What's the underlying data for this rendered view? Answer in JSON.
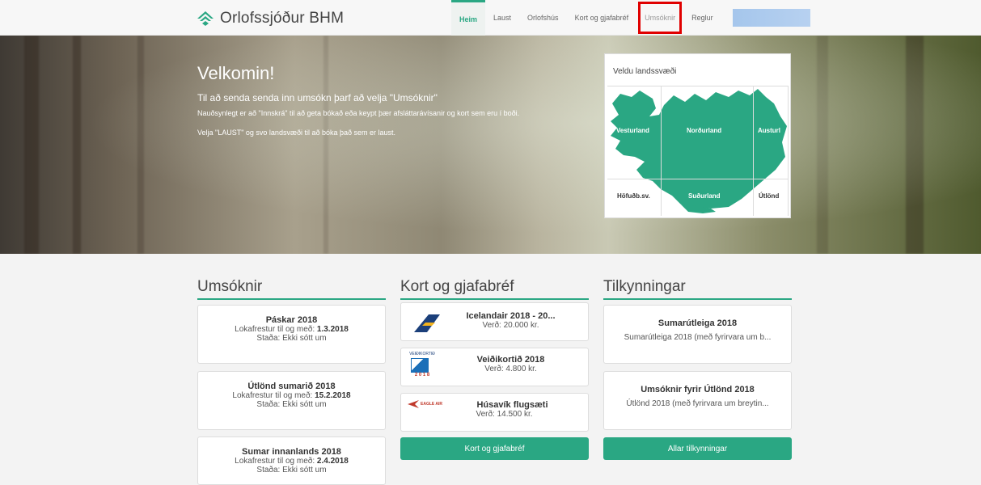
{
  "header": {
    "logo_text": "Orlofssjóður BHM",
    "nav": [
      {
        "label": "Heim"
      },
      {
        "label": "Laust"
      },
      {
        "label": "Orlofshús"
      },
      {
        "label": "Kort og gjafabréf"
      },
      {
        "label": "Umsóknir"
      },
      {
        "label": "Reglur"
      }
    ]
  },
  "hero": {
    "title": "Velkomin!",
    "subtitle": "Til að senda senda inn umsókn þarf að velja \"Umsóknir\"",
    "note1": "Nauðsynlegt er að \"Innskrá\" til að geta bókað eða keypt þær afsláttarávísanir  og kort sem eru í boði.",
    "note2": "Velja \"LAUST\" og svo landsvæði til að bóka það sem er laust."
  },
  "map": {
    "title": "Veldu landssvæði",
    "regions": [
      "Vesturland",
      "Norðurland",
      "Austurl",
      "Höfuðb.sv.",
      "Suðurland",
      "Útlönd"
    ],
    "color": "#2aa783"
  },
  "umsoknir": {
    "heading": "Umsóknir",
    "items": [
      {
        "title": "Páskar 2018",
        "deadline_label": "Lokafrestur til og með:",
        "deadline": "1.3.2018",
        "status": "Staða: Ekki sótt um"
      },
      {
        "title": "Útlönd sumarið 2018",
        "deadline_label": "Lokafrestur til og með:",
        "deadline": "15.2.2018",
        "status": "Staða: Ekki sótt um"
      },
      {
        "title": "Sumar innanlands 2018",
        "deadline_label": "Lokafrestur til og með:",
        "deadline": "2.4.2018",
        "status": "Staða: Ekki sótt um"
      }
    ]
  },
  "kort": {
    "heading": "Kort og gjafabréf",
    "items": [
      {
        "title": "Icelandair 2018 - 20...",
        "price": "Verð: 20.000 kr."
      },
      {
        "title": "Veiðikortið 2018",
        "price": "Verð: 4.800 kr.",
        "thumb_text": "VEIÐIKORTIÐ",
        "thumb_year": "2 0 1 8"
      },
      {
        "title": "Húsavík flugsæti",
        "price": "Verð: 14.500 kr.",
        "thumb_text": "EAGLE AIR"
      }
    ],
    "button": "Kort og gjafabréf"
  },
  "tilkynningar": {
    "heading": "Tilkynningar",
    "items": [
      {
        "title": "Sumarútleiga 2018",
        "text": "Sumarútleiga 2018 (með fyrirvara um b..."
      },
      {
        "title": "Umsóknir fyrir Útlönd 2018",
        "text": "Útlönd 2018 (með fyrirvara um breytin..."
      }
    ],
    "button": "Allar tilkynningar"
  },
  "colors": {
    "accent": "#2aa783",
    "highlight": "#e00000"
  }
}
